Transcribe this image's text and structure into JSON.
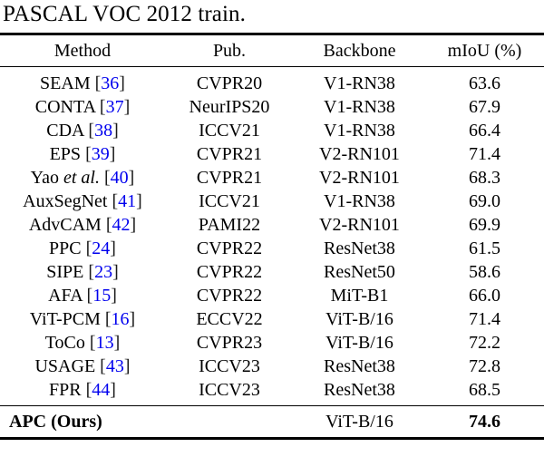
{
  "caption": {
    "text": "PASCAL VOC 2012 train."
  },
  "table": {
    "columns": [
      {
        "key": "method",
        "label": "Method"
      },
      {
        "key": "pub",
        "label": "Pub."
      },
      {
        "key": "backbone",
        "label": "Backbone"
      },
      {
        "key": "miou",
        "label": "mIoU (%)"
      }
    ],
    "cite_color": "#0000ee",
    "rows": [
      {
        "method": "SEAM",
        "cite": "36",
        "pub": "CVPR20",
        "backbone": "V1-RN38",
        "miou": "63.6"
      },
      {
        "method": "CONTA",
        "cite": "37",
        "pub": "NeurIPS20",
        "backbone": "V1-RN38",
        "miou": "67.9"
      },
      {
        "method": "CDA",
        "cite": "38",
        "pub": "ICCV21",
        "backbone": "V1-RN38",
        "miou": "66.4"
      },
      {
        "method": "EPS",
        "cite": "39",
        "pub": "CVPR21",
        "backbone": "V2-RN101",
        "miou": "71.4"
      },
      {
        "method": "Yao et al.",
        "cite": "40",
        "pub": "CVPR21",
        "backbone": "V2-RN101",
        "miou": "68.3",
        "italic_part": "et al."
      },
      {
        "method": "AuxSegNet",
        "cite": "41",
        "pub": "ICCV21",
        "backbone": "V1-RN38",
        "miou": "69.0"
      },
      {
        "method": "AdvCAM",
        "cite": "42",
        "pub": "PAMI22",
        "backbone": "V2-RN101",
        "miou": "69.9"
      },
      {
        "method": "PPC",
        "cite": "24",
        "pub": "CVPR22",
        "backbone": "ResNet38",
        "miou": "61.5"
      },
      {
        "method": "SIPE",
        "cite": "23",
        "pub": "CVPR22",
        "backbone": "ResNet50",
        "miou": "58.6"
      },
      {
        "method": "AFA",
        "cite": "15",
        "pub": "CVPR22",
        "backbone": "MiT-B1",
        "miou": "66.0"
      },
      {
        "method": "ViT-PCM",
        "cite": "16",
        "pub": "ECCV22",
        "backbone": "ViT-B/16",
        "miou": "71.4"
      },
      {
        "method": "ToCo",
        "cite": "13",
        "pub": "CVPR23",
        "backbone": "ViT-B/16",
        "miou": "72.2"
      },
      {
        "method": "USAGE",
        "cite": "43",
        "pub": "ICCV23",
        "backbone": "ResNet38",
        "miou": "72.8"
      },
      {
        "method": "FPR",
        "cite": "44",
        "pub": "ICCV23",
        "backbone": "ResNet38",
        "miou": "68.5"
      }
    ],
    "ours_row": {
      "method": "APC (Ours)",
      "pub": "",
      "backbone": "ViT-B/16",
      "miou": "74.6"
    }
  }
}
